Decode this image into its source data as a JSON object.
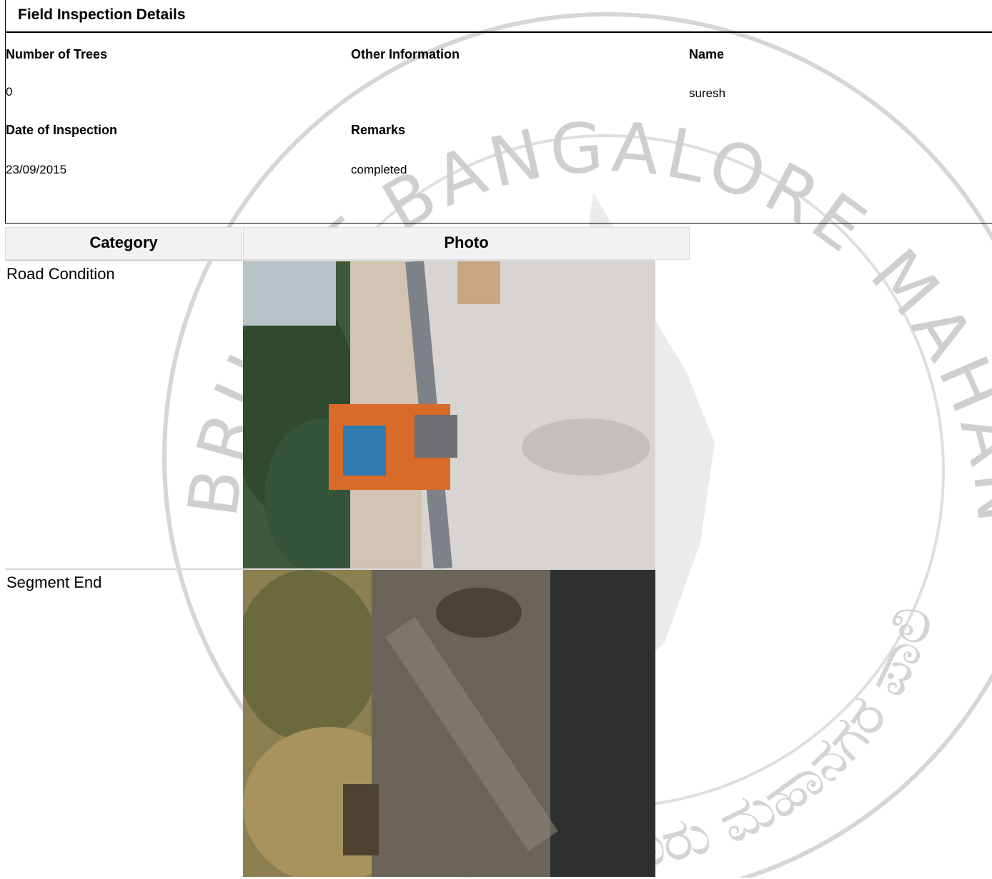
{
  "field_inspection": {
    "title": "Field Inspection Details",
    "number_of_trees_label": "Number of Trees",
    "number_of_trees": "0",
    "other_information_label": "Other Information",
    "other_information": "",
    "name_label": "Name",
    "name": "suresh",
    "date_label": "Date of Inspection",
    "date": "23/09/2015",
    "remarks_label": "Remarks",
    "remarks": "completed"
  },
  "photos_table": {
    "headers": [
      "Category",
      "Photo"
    ],
    "rows": [
      {
        "category": "Road Condition",
        "photo_icon": "road-condition-photo"
      },
      {
        "category": "Segment End",
        "photo_icon": "segment-end-photo"
      }
    ]
  },
  "watermark": {
    "text_top": "BRUHAT BANGALORE MAHANAGARA PALIKE",
    "text_kannada": "ಬೃಹತ್ ಬೆಂಗಳೂರು ಮಹಾನಗರ ಪಾಲಿಕೆ",
    "color": "#c8c8c8"
  },
  "colors": {
    "header_bg": "#f2f2f2",
    "row_divider": "#d9d9d9",
    "text": "#000000"
  }
}
